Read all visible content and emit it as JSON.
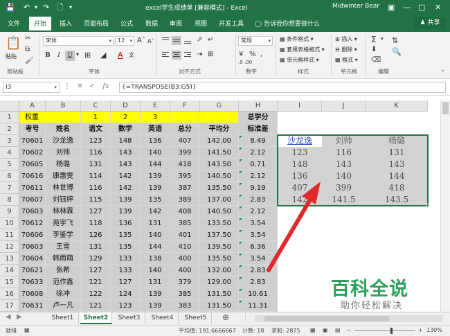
{
  "titlebar": {
    "title": "excel学生成绩单 [兼容模式] - Excel",
    "user": "Midwinter Bear"
  },
  "menu": {
    "items": [
      "文件",
      "开始",
      "插入",
      "页面布局",
      "公式",
      "数据",
      "审阅",
      "视图",
      "开发工具"
    ],
    "active_index": 1,
    "tellme": "告诉我你想要做什么",
    "share": "共享"
  },
  "ribbon": {
    "paste": "粘贴",
    "clipboard_group": "剪贴板",
    "font_name": "宋体",
    "font_size": "12",
    "font_group": "字体",
    "align_group": "对齐方式",
    "number_format": "常规",
    "number_group": "数字",
    "styles": [
      "条件格式",
      "套用表格格式",
      "单元格样式"
    ],
    "styles_group": "样式",
    "cells": [
      "插入",
      "删除",
      "格式"
    ],
    "cells_group": "单元格",
    "edit_group": "编辑",
    "bold": "B",
    "italic": "I",
    "underline": "U"
  },
  "formula_bar": {
    "name_box": "I3",
    "fx": "fx",
    "formula": "{=TRANSPOSE(B3:G5)}"
  },
  "columns": [
    "A",
    "B",
    "C",
    "D",
    "E",
    "F",
    "G",
    "H",
    "I",
    "J",
    "K"
  ],
  "rows": [
    "1",
    "2",
    "3",
    "4",
    "5",
    "6",
    "7",
    "8",
    "9",
    "10",
    "11",
    "12",
    "13",
    "14",
    "15",
    "16",
    "17"
  ],
  "row1": {
    "a": "权重",
    "c": "1",
    "d": "2",
    "e": "3",
    "h": "总学分"
  },
  "headers": [
    "考号",
    "姓名",
    "语文",
    "数学",
    "英语",
    "总分",
    "平均分",
    "标准差"
  ],
  "students": [
    [
      "70601",
      "沙龙逸",
      "123",
      "148",
      "136",
      "407",
      "142.00",
      "8.49"
    ],
    [
      "70602",
      "刘帅",
      "116",
      "143",
      "140",
      "399",
      "141.50",
      "2.12"
    ],
    [
      "70605",
      "杨璐",
      "131",
      "143",
      "144",
      "418",
      "143.50",
      "0.71"
    ],
    [
      "70616",
      "康惠雯",
      "114",
      "142",
      "139",
      "395",
      "140.50",
      "2.12"
    ],
    [
      "70611",
      "林世博",
      "116",
      "142",
      "139",
      "387",
      "135.50",
      "9.19"
    ],
    [
      "70607",
      "刘钰婷",
      "115",
      "139",
      "135",
      "389",
      "137.00",
      "2.83"
    ],
    [
      "70603",
      "林林霖",
      "127",
      "139",
      "142",
      "408",
      "140.50",
      "2.12"
    ],
    [
      "70612",
      "苑宇飞",
      "118",
      "136",
      "131",
      "385",
      "133.50",
      "3.54"
    ],
    [
      "70606",
      "李鉴学",
      "126",
      "135",
      "140",
      "401",
      "137.50",
      "3.54"
    ],
    [
      "70603",
      "王雪",
      "131",
      "135",
      "144",
      "410",
      "139.50",
      "6.36"
    ],
    [
      "70604",
      "韩雨萌",
      "129",
      "133",
      "138",
      "400",
      "135.50",
      "3.54"
    ],
    [
      "70621",
      "张希",
      "127",
      "133",
      "140",
      "400",
      "132.00",
      "2.83"
    ],
    [
      "70633",
      "范作鑫",
      "121",
      "127",
      "131",
      "379",
      "129.00",
      "2.83"
    ],
    [
      "70608",
      "徐冲",
      "122",
      "124",
      "139",
      "385",
      "131.50",
      "10.61"
    ],
    [
      "70631",
      "卢一凡",
      "121",
      "123",
      "139",
      "383",
      "131.50",
      "11.31"
    ]
  ],
  "transposed": {
    "header": [
      "沙龙逸",
      "刘帅",
      "杨璐"
    ],
    "rows": [
      [
        "123",
        "116",
        "131"
      ],
      [
        "148",
        "143",
        "143"
      ],
      [
        "136",
        "140",
        "144"
      ],
      [
        "407",
        "399",
        "418"
      ],
      [
        "142",
        "141.5",
        "143.5"
      ]
    ]
  },
  "sheets": [
    "Sheet1",
    "Sheet2",
    "Sheet3",
    "Sheet4",
    "Sheet5"
  ],
  "active_sheet_index": 1,
  "status": {
    "ready": "就绪",
    "average": "平均值: 191.6666667",
    "count": "计数: 18",
    "sum": "求和: 2875",
    "zoom": "130%"
  },
  "watermark": {
    "title": "百科全说",
    "subtitle": "助你轻松解决"
  },
  "colors": {
    "excel_green": "#217346",
    "weight_row": "#ffff00",
    "selection_fill": "#cfcfcf",
    "arrow": "#e02a2a",
    "watermark": "#2ca05a"
  }
}
